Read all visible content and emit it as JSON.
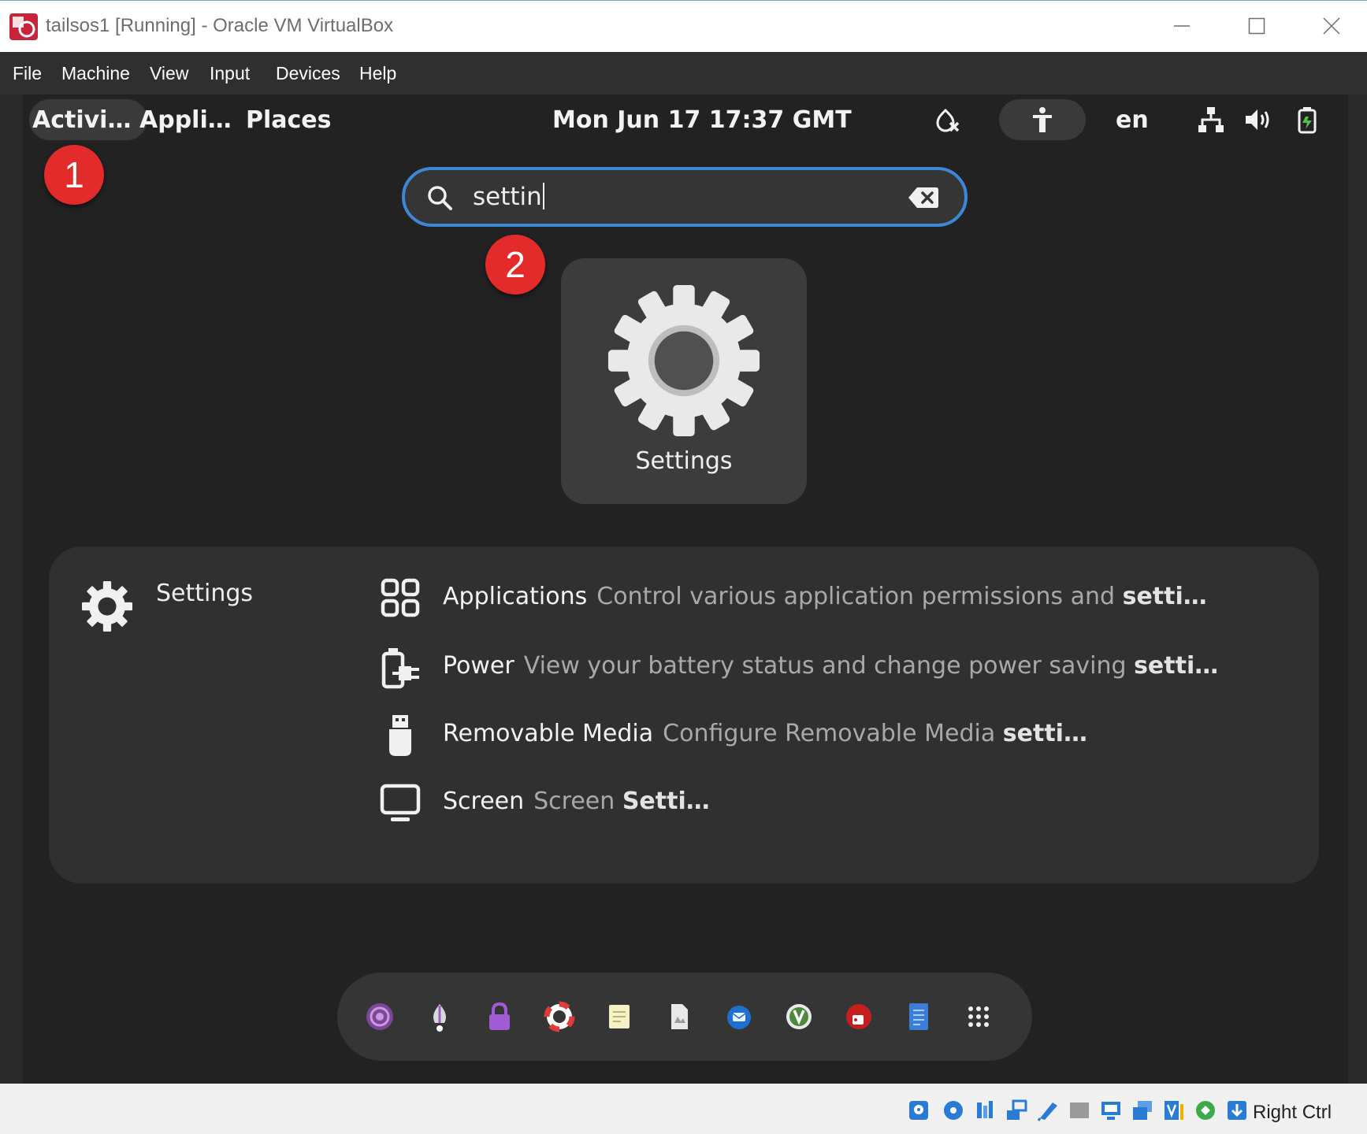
{
  "window": {
    "title": "tailsos1 [Running] - Oracle VM VirtualBox",
    "controls": {
      "minimize": "minimize-icon",
      "maximize": "maximize-icon",
      "close": "close-icon"
    }
  },
  "menubar": {
    "items": [
      "File",
      "Machine",
      "View",
      "Input",
      "Devices",
      "Help"
    ]
  },
  "topbar": {
    "activities": "Activi…",
    "applications": "Appli…",
    "places": "Places",
    "clock": "Mon Jun 17  17:37 GMT",
    "keyboard_layout": "en",
    "tray_icons": [
      "tor-connection-icon",
      "accessibility-icon",
      "network-icon",
      "volume-icon",
      "battery-icon"
    ]
  },
  "annotations": {
    "step1": "1",
    "step2": "2",
    "color": "#e32b2b"
  },
  "search": {
    "value": "settin",
    "icon": "search-icon",
    "clear_icon": "clear-icon",
    "accent": "#3f86d6"
  },
  "app_result": {
    "label": "Settings",
    "icon": "settings-gear-icon"
  },
  "settings_results": {
    "provider": "Settings",
    "rows": [
      {
        "name": "Applications",
        "desc": "Control various application permissions and",
        "highlight": "setti…",
        "icon": "applications-grid-icon"
      },
      {
        "name": "Power",
        "desc": "View your battery status and change power saving",
        "highlight": "setti…",
        "icon": "power-plug-icon"
      },
      {
        "name": "Removable Media",
        "desc": "Configure Removable Media",
        "highlight": "setti…",
        "icon": "usb-drive-icon"
      },
      {
        "name": "Screen",
        "desc": "Screen",
        "highlight": "Setti…",
        "icon": "monitor-icon"
      }
    ]
  },
  "dash": {
    "icons": [
      "tor-browser-icon",
      "onion-share-icon",
      "keepassxc-icon",
      "help-lifebuoy-icon",
      "text-editor-icon",
      "files-icon",
      "thunderbird-icon",
      "electrum-icon",
      "pidgin-icon",
      "documents-icon",
      "show-apps-grid-icon"
    ]
  },
  "statusbar": {
    "host_key": "Right Ctrl",
    "icons": [
      "hard-disk-icon",
      "optical-drive-icon",
      "audio-icon",
      "network-adapters-icon",
      "usb-icon",
      "shared-folders-icon",
      "display-icon",
      "recording-icon",
      "vt-x-icon",
      "mouse-integration-icon",
      "keyboard-capture-icon"
    ]
  }
}
